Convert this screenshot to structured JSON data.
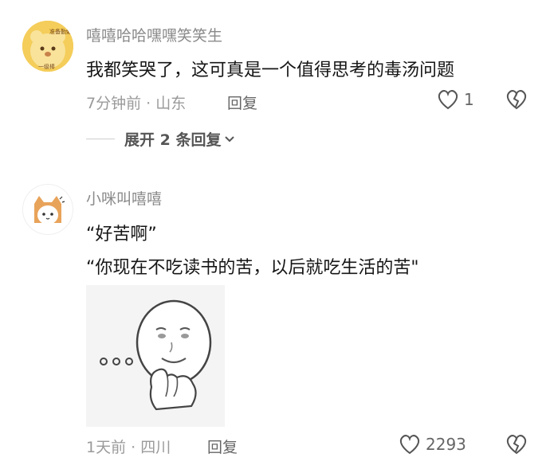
{
  "comments": [
    {
      "username": "嘻嘻哈哈嘿嘿笑笑生",
      "avatar_text_top": "准备勤勉",
      "avatar_text_bottom": "一级棒",
      "text": "我都笑哭了，这可真是一个值得思考的毒汤问题",
      "meta": "7分钟前 · 山东",
      "reply_label": "回复",
      "like_count": "1",
      "expand_label": "展开 2 条回复"
    },
    {
      "username": "小咪叫嘻嘻",
      "text_lines": [
        "“好苦啊”",
        "“你现在不吃读书的苦，以后就吃生活的苦\""
      ],
      "sticker_caption": "…",
      "meta": "1天前 · 四川",
      "reply_label": "回复",
      "like_count": "2293"
    }
  ],
  "icons": {
    "like": "heart-outline-icon",
    "dislike": "broken-heart-icon",
    "expand": "chevron-down-icon"
  },
  "colors": {
    "username": "#8a8a8a",
    "text": "#161616",
    "meta": "#9a9a9a",
    "icon": "#555555"
  }
}
